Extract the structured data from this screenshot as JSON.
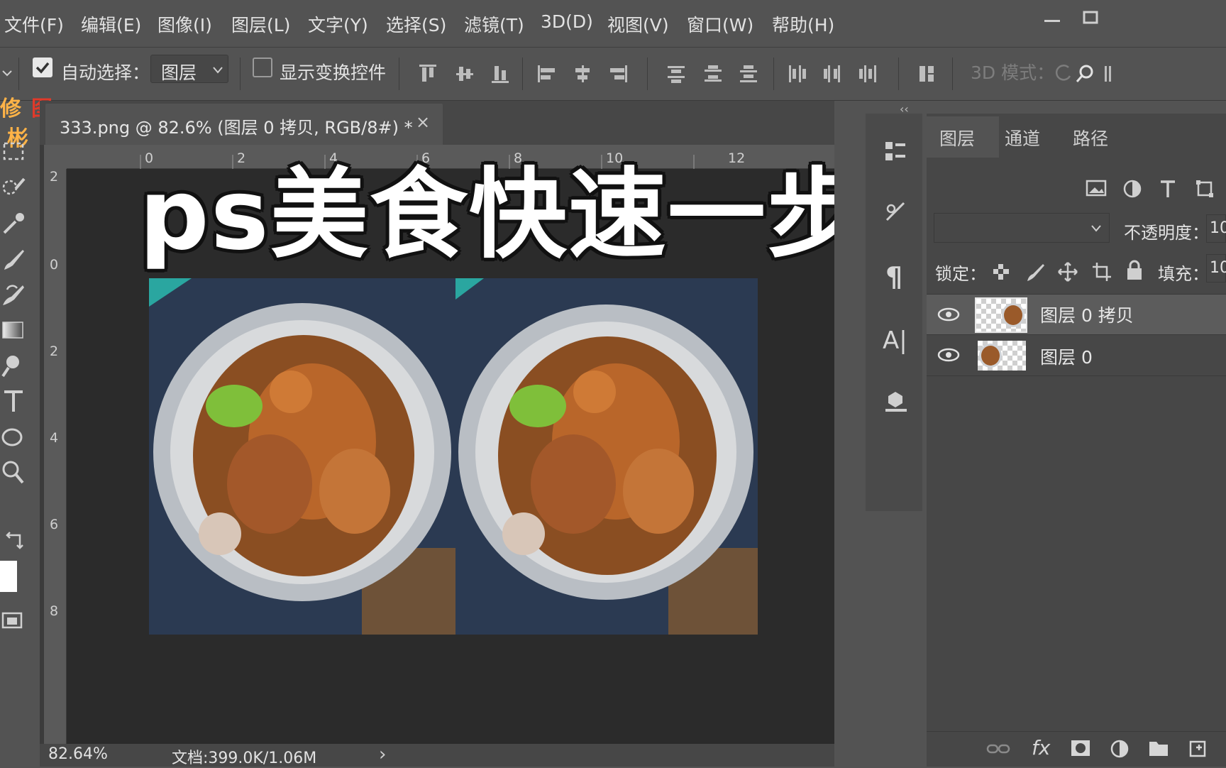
{
  "menubar": {
    "items": [
      "文件(F)",
      "编辑(E)",
      "图像(I)",
      "图层(L)",
      "文字(Y)",
      "选择(S)",
      "滤镜(T)",
      "3D(D)",
      "视图(V)",
      "窗口(W)",
      "帮助(H)"
    ]
  },
  "optionsbar": {
    "auto_select_label": "自动选择：",
    "auto_select_checked": true,
    "auto_select_target": "图层",
    "show_transform_label": "显示变换控件",
    "show_transform_checked": false,
    "mode_3d_label": "3D 模式："
  },
  "tool_logo_chars": [
    "修",
    "图",
    "彬"
  ],
  "document": {
    "tab_label": "333.png @ 82.6% (图层 0 拷贝, RGB/8#) *",
    "close_glyph": "×",
    "hruler_ticks": [
      "0",
      "2",
      "4",
      "6",
      "8",
      "10",
      "12"
    ],
    "vruler_ticks": [
      "2",
      "0",
      "2",
      "4",
      "6",
      "8"
    ]
  },
  "overlay": {
    "title": "ps美食快速一步调色"
  },
  "statusbar": {
    "zoom": "82.64%",
    "doc_info": "文档:399.0K/1.06M",
    "arrow": "›"
  },
  "dock": {
    "collapse_glyph": "‹‹",
    "paragraph_glyph": "¶",
    "char_glyph": "A|"
  },
  "layers_panel": {
    "tabs": [
      "图层",
      "通道",
      "路径"
    ],
    "opacity_label": "不透明度：",
    "opacity_value": "10",
    "lock_label": "锁定：",
    "fill_label": "填充：",
    "fill_value": "10",
    "layers": [
      {
        "name": "图层 0 拷贝",
        "selected": true
      },
      {
        "name": "图层 0",
        "selected": false
      }
    ],
    "footer_fx": "fx"
  },
  "colors": {
    "ui_bg": "#535353",
    "canvas_bg": "#2b2b2b",
    "logo_red": "#e03a2a",
    "logo_orange": "#ffb347"
  }
}
